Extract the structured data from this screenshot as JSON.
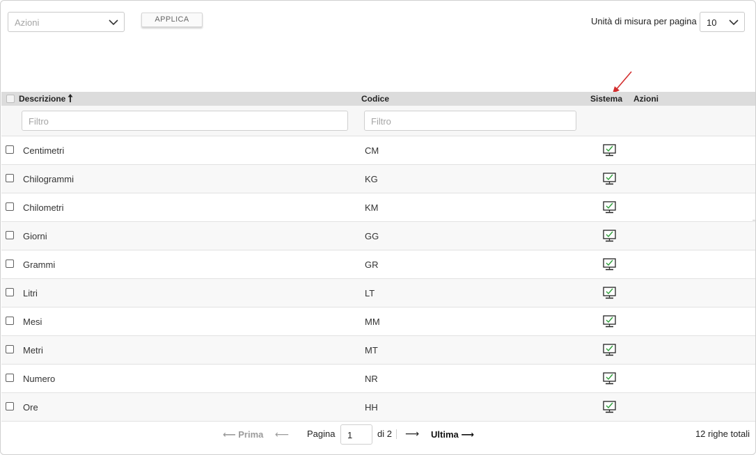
{
  "toolbar": {
    "actions_placeholder": "Azioni",
    "apply_label": "APPLICA",
    "per_page_label": "Unità di misura per pagina",
    "per_page_value": "10"
  },
  "table": {
    "columns": {
      "description": "Descrizione",
      "code": "Codice",
      "system": "Sistema",
      "actions": "Azioni"
    },
    "sort_icon": "sort-ascending-arrow-icon",
    "filter_placeholder_description": "Filtro",
    "filter_placeholder_code": "Filtro",
    "system_icon": "monitor-check-icon",
    "rows": [
      {
        "description": "Centimetri",
        "code": "CM"
      },
      {
        "description": "Chilogrammi",
        "code": "KG"
      },
      {
        "description": "Chilometri",
        "code": "KM"
      },
      {
        "description": "Giorni",
        "code": "GG"
      },
      {
        "description": "Grammi",
        "code": "GR"
      },
      {
        "description": "Litri",
        "code": "LT"
      },
      {
        "description": "Mesi",
        "code": "MM"
      },
      {
        "description": "Metri",
        "code": "MT"
      },
      {
        "description": "Numero",
        "code": "NR"
      },
      {
        "description": "Ore",
        "code": "HH"
      }
    ]
  },
  "pagination": {
    "first_label": "⟵ Prima",
    "prev_symbol": "⟵",
    "page_label": "Pagina",
    "current_page": "1",
    "of_label": "di 2",
    "next_symbol": "⟶",
    "last_label": "Ultima ⟶",
    "total_label": "12 righe totali"
  },
  "colors": {
    "header_bg": "#dcdcdc",
    "row_alt_bg": "#f8f8f8",
    "annotation_arrow": "#d32f2f",
    "check_green": "#2e9e3a"
  }
}
